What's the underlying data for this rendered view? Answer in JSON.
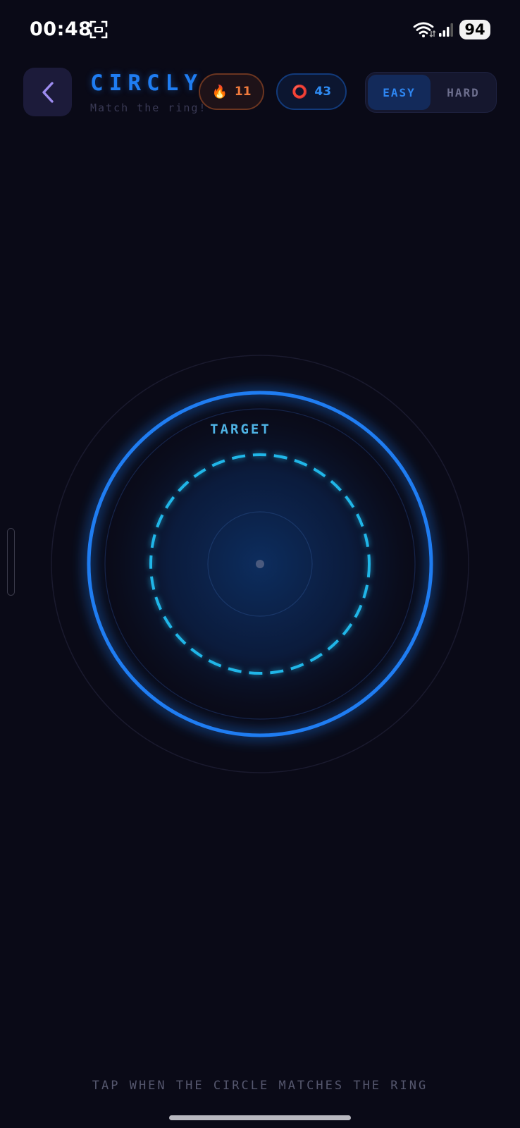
{
  "status_bar": {
    "time": "00:48",
    "battery": "94"
  },
  "header": {
    "title": "CIRCLY",
    "subtitle": "Match the ring!",
    "streak": {
      "icon": "fire-icon",
      "emoji": "🔥",
      "value": "11"
    },
    "score": {
      "icon": "ring-icon",
      "emoji": "⭕",
      "value": "43"
    },
    "difficulty": {
      "options": [
        "EASY",
        "HARD"
      ],
      "selected": "EASY"
    }
  },
  "game": {
    "target_label": "TARGET"
  },
  "instructions": "TAP WHEN THE CIRCLE MATCHES THE RING",
  "colors": {
    "background": "#0a0a17",
    "accent_blue": "#1f7df2",
    "target_cyan": "#20b6e8",
    "streak_orange": "#f07a3c",
    "panel": "#1c1b3a"
  }
}
